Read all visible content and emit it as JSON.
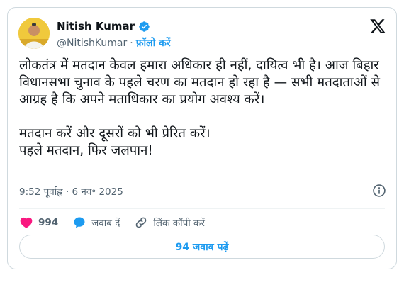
{
  "author": {
    "name": "Nitish Kumar",
    "handle": "@NitishKumar",
    "separator": "·",
    "follow_label": "फ़ॉलो करें",
    "verified_icon": "verified-badge-icon"
  },
  "tweet": {
    "text": "लोकतंत्र में मतदान केवल हमारा अधिकार ही नहीं, दायित्व भी है। आज बिहार विधानसभा चुनाव के पहले चरण का मतदान हो रहा है — सभी मतदाताओं से आग्रह है कि अपने मताधिकार का प्रयोग अवश्य करें।\n\nमतदान करें और दूसरों को भी प्रेरित करें।\nपहले मतदान, फिर जलपान!",
    "timestamp": "9:52 पूर्वाह्न · 6 नव॰ 2025"
  },
  "actions": {
    "like_count": "994",
    "reply_label": "जवाब दें",
    "copy_link_label": "लिंक कॉपी करें"
  },
  "replies_button": {
    "label": "94 जवाब पढ़ें"
  },
  "colors": {
    "accent": "#1d9bf0",
    "like": "#f91880",
    "text": "#0f1419",
    "muted": "#536471",
    "border": "#cfd9de"
  }
}
